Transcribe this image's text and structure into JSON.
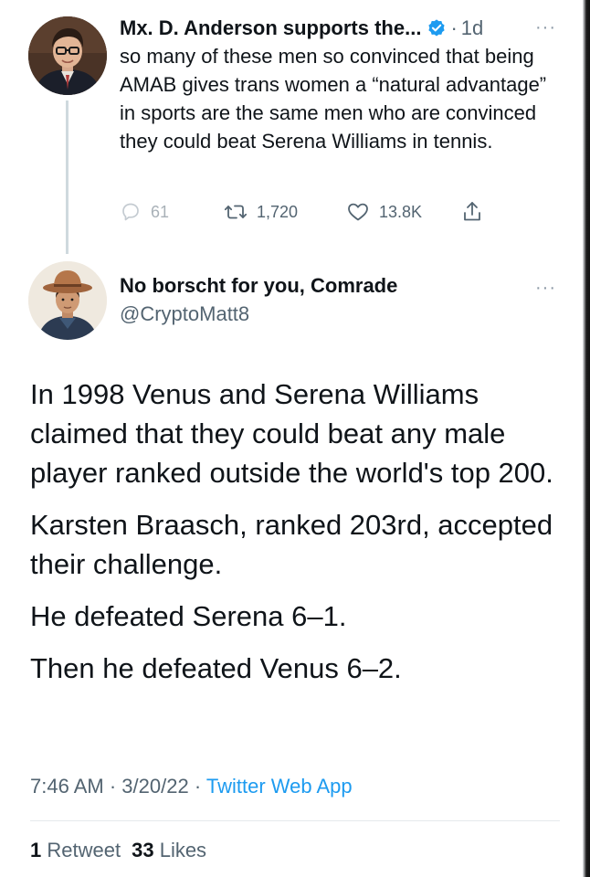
{
  "parent_tweet": {
    "display_name": "Mx. D. Anderson supports the...",
    "verified": true,
    "time_separator": "·",
    "time": "1d",
    "more": "···",
    "text": "so many of these men so convinced that being AMAB gives trans women a “natural advantage” in sports are the same men who are convinced they could beat Serena Williams in tennis.",
    "actions": {
      "replies": "61",
      "retweets": "1,720",
      "likes": "13.8K"
    }
  },
  "main_tweet": {
    "display_name": "No borscht for you, Comrade",
    "handle": "@CryptoMatt8",
    "more": "···",
    "paragraphs": [
      "In 1998 Venus and Serena Williams claimed that they could beat any male player ranked outside the world's top 200.",
      "Karsten Braasch, ranked 203rd, accepted their challenge.",
      "He defeated Serena 6–1.",
      "Then he defeated Venus 6–2."
    ],
    "time": "7:46 AM",
    "date": "3/20/22",
    "meta_separator": "·",
    "source": "Twitter Web App",
    "retweet_count": "1",
    "retweet_label": "Retweet",
    "like_count": "33",
    "like_label": "Likes"
  },
  "colors": {
    "text": "#0f1419",
    "secondary": "#536471",
    "link": "#1d9bf0",
    "verified": "#1d9bf0",
    "thread_line": "#cfd9de"
  },
  "icons": {
    "reply": "reply-icon",
    "retweet": "retweet-icon",
    "like": "heart-icon",
    "share": "share-icon",
    "verified": "verified-badge-icon",
    "more": "more-icon"
  }
}
